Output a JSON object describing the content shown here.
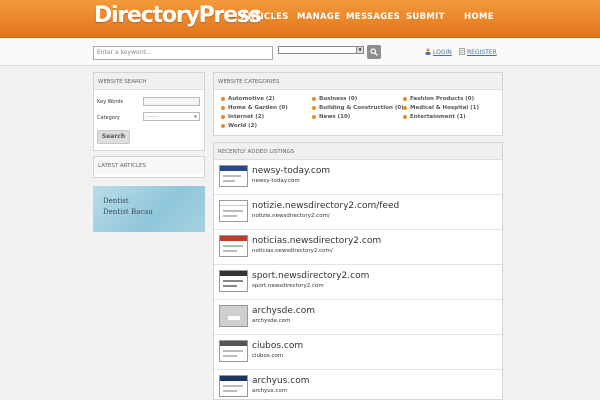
{
  "header": {
    "logo": "DirectoryPress",
    "nav": [
      "ARTICLES",
      "MANAGE",
      "MESSAGES",
      "SUBMIT",
      "HOME"
    ]
  },
  "search": {
    "keyword_placeholder": "Enter a keyword...",
    "login": "LOGIN",
    "register": "REGISTER"
  },
  "sidebar": {
    "search_title": "WEBSITE SEARCH",
    "keywords_label": "Key Words",
    "category_label": "Category",
    "category_value": "--------",
    "search_button": "Search",
    "latest_title": "LATEST ARTICLES",
    "ad": {
      "line1": "Dentist",
      "line2": "Dentist Bacau"
    }
  },
  "categories": {
    "title": "WEBSITE CATEGORIES",
    "items": [
      "Automotive (2)",
      "Home & Garden (0)",
      "Internet (2)",
      "World (2)",
      "Business (0)",
      "Building & Construction (0)",
      "News (10)",
      "Fashion Products (0)",
      "Medical & Hospital (1)",
      "Entertainment (1)"
    ]
  },
  "listings": {
    "title": "RECENTLY ADDED LISTINGS",
    "items": [
      {
        "title": "newsy-today.com",
        "url": "newsy-today.com"
      },
      {
        "title": "notizie.newsdirectory2.com/feed",
        "url": "notizie.newsdirectory2.com/"
      },
      {
        "title": "noticias.newsdirectory2.com",
        "url": "noticias.newsdirectory2.com/"
      },
      {
        "title": "sport.newsdirectory2.com",
        "url": "sport.newsdirectory2.com"
      },
      {
        "title": "archysde.com",
        "url": "archysde.com"
      },
      {
        "title": "ciubos.com",
        "url": "ciubos.com"
      },
      {
        "title": "archyus.com",
        "url": "archyus.com"
      }
    ]
  }
}
